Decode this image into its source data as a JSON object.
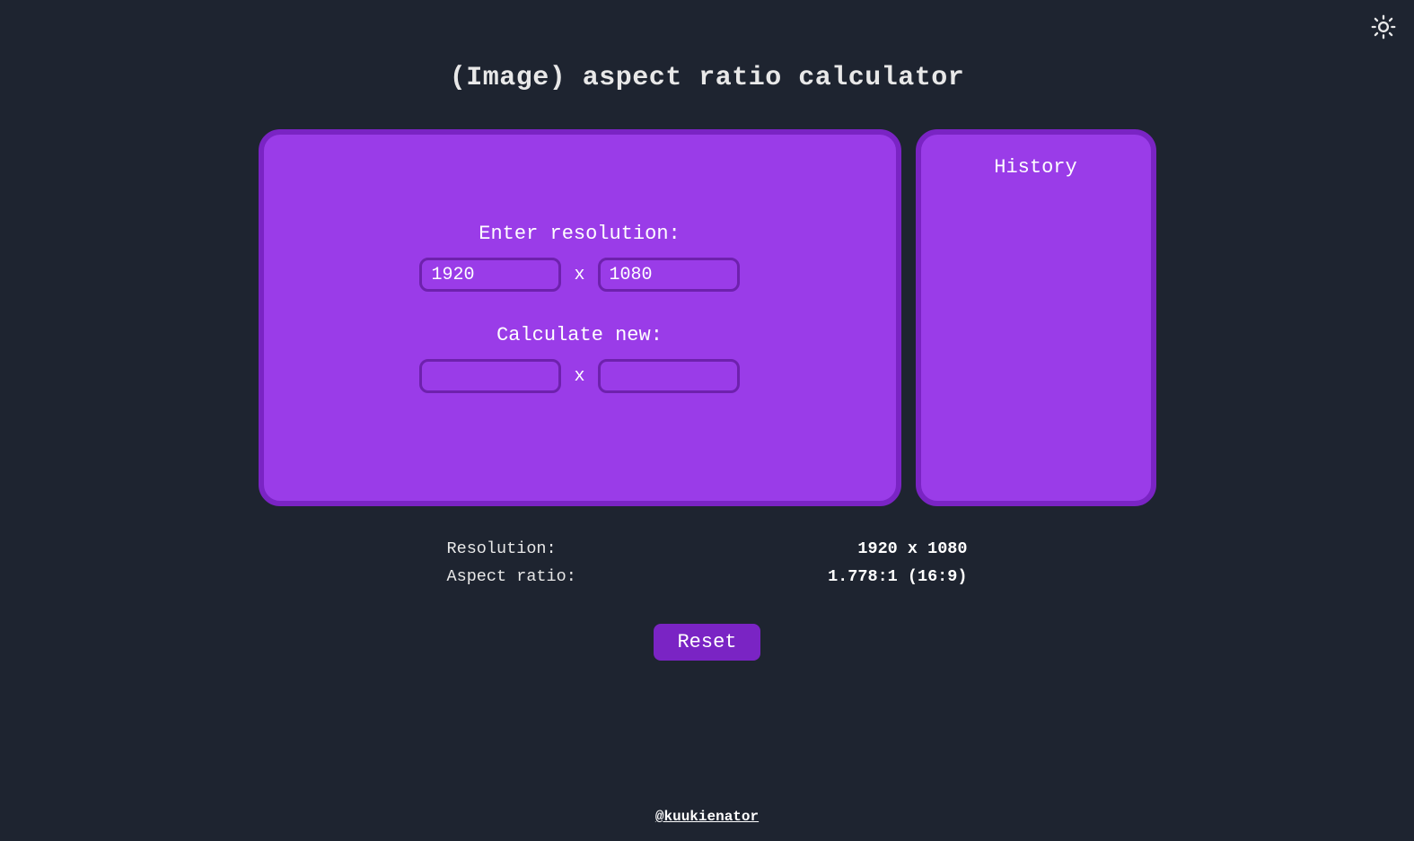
{
  "header": {
    "title": "(Image) aspect ratio calculator",
    "theme_icon": "sun-icon"
  },
  "main": {
    "enter_label": "Enter resolution:",
    "calc_label": "Calculate new:",
    "separator": "x",
    "width_value": "1920",
    "height_value": "1080",
    "new_width_value": "",
    "new_height_value": ""
  },
  "history": {
    "title": "History",
    "items": []
  },
  "results": {
    "resolution_label": "Resolution:",
    "resolution_value": "1920 x 1080",
    "aspect_label": "Aspect ratio:",
    "aspect_value": "1.778:1 (16:9)"
  },
  "actions": {
    "reset_label": "Reset"
  },
  "footer": {
    "credit": "@kuukienator"
  }
}
